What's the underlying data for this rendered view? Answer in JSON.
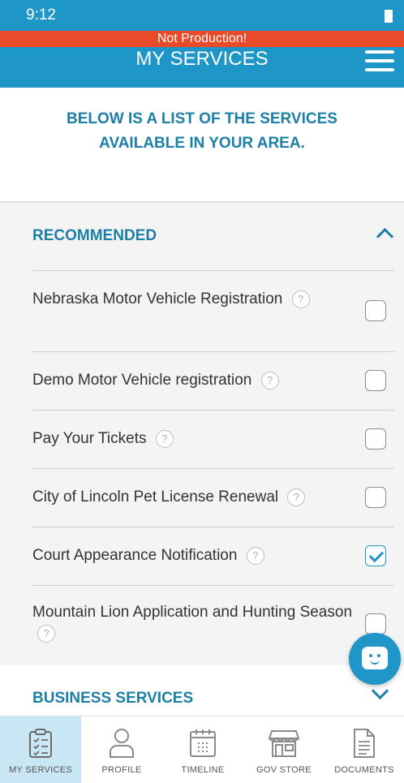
{
  "status_bar": {
    "time": "9:12"
  },
  "banner": {
    "text": "Not Production!"
  },
  "header": {
    "title": "MY SERVICES"
  },
  "intro": {
    "text": "BELOW IS A LIST OF THE SERVICES AVAILABLE IN YOUR AREA."
  },
  "recommended": {
    "title": "RECOMMENDED",
    "items": [
      {
        "label": "Nebraska Motor Vehicle Registration",
        "checked": false
      },
      {
        "label": "Demo Motor Vehicle registration",
        "checked": false
      },
      {
        "label": "Pay Your Tickets",
        "checked": false
      },
      {
        "label": "City of Lincoln Pet License Renewal",
        "checked": false
      },
      {
        "label": "Court Appearance Notification",
        "checked": true
      },
      {
        "label": "Mountain Lion Application and Hunting Season",
        "checked": false
      }
    ]
  },
  "business": {
    "title": "BUSINESS SERVICES"
  },
  "help_glyph": "?",
  "nav": {
    "items": [
      {
        "label": "MY SERVICES",
        "icon": "clipboard-icon",
        "active": true
      },
      {
        "label": "PROFILE",
        "icon": "person-icon",
        "active": false
      },
      {
        "label": "TIMELINE",
        "icon": "calendar-icon",
        "active": false
      },
      {
        "label": "GOV STORE",
        "icon": "storefront-icon",
        "active": false
      },
      {
        "label": "DOCUMENTS",
        "icon": "document-icon",
        "active": false
      }
    ]
  },
  "colors": {
    "primary": "#1e96c8",
    "accent_text": "#1d7fa6",
    "banner": "#e84a2a",
    "list_bg": "#f4f4f4"
  }
}
